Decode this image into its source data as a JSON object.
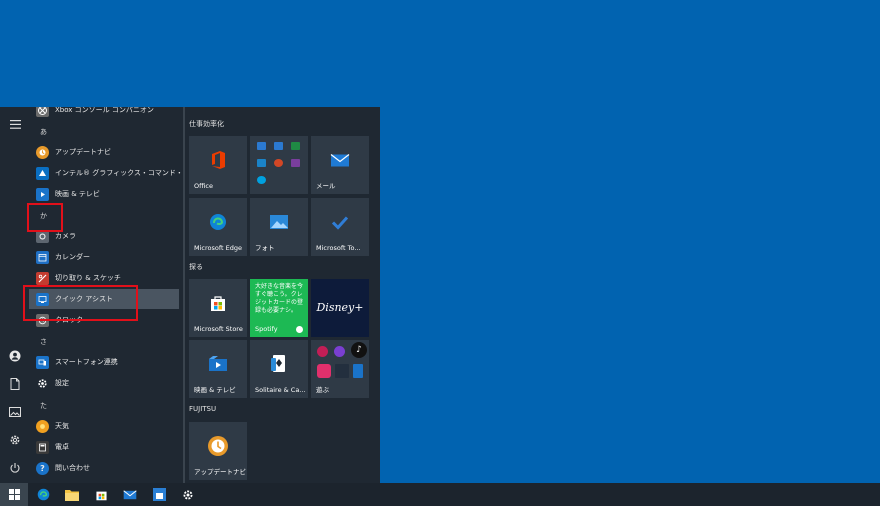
{
  "app_list": {
    "items": [
      {
        "label": "Xbox コンソール コンパニオン",
        "icon": "xbox-companion-icon",
        "color": "#6b6b6b"
      },
      {
        "letter": "あ"
      },
      {
        "label": "アップデートナビ",
        "icon": "update-navi-icon",
        "color": "#e89a2b"
      },
      {
        "label": "インテル® グラフィックス・コマンド・センター",
        "icon": "intel-graphics-icon",
        "color": "#0a6fc2"
      },
      {
        "label": "映画 & テレビ",
        "icon": "movies-tv-icon",
        "color": "#1a73c9"
      },
      {
        "letter": "か"
      },
      {
        "label": "カメラ",
        "icon": "camera-icon",
        "color": "#5d6670"
      },
      {
        "label": "カレンダー",
        "icon": "calendar-icon",
        "color": "#1f6fc4"
      },
      {
        "label": "切り取り & スケッチ",
        "icon": "snip-sketch-icon",
        "color": "#c43c30"
      },
      {
        "label": "クイック アシスト",
        "icon": "quick-assist-icon",
        "color": "#1a73c9"
      },
      {
        "label": "クロック",
        "icon": "clock-icon",
        "color": "#6b6b6b"
      },
      {
        "letter": "さ"
      },
      {
        "label": "スマートフォン連携",
        "icon": "phone-link-icon",
        "color": "#1a73c9"
      },
      {
        "label": "設定",
        "icon": "gear-icon",
        "color": "#1f2832"
      },
      {
        "letter": "た"
      },
      {
        "label": "天気",
        "icon": "weather-icon",
        "color": "#f0a020"
      },
      {
        "label": "電卓",
        "icon": "calculator-icon",
        "color": "#3a3a3a"
      },
      {
        "label": "問い合わせ",
        "icon": "help-icon",
        "color": "#1a73c9"
      }
    ]
  },
  "tile_groups": {
    "productivity": "仕事効率化",
    "explore": "探る",
    "fujitsu": "FUJITSU"
  },
  "tiles": {
    "office": "Office",
    "mail": "メール",
    "edge": "Microsoft Edge",
    "photos": "フォト",
    "todo": "Microsoft To...",
    "store": "Microsoft Store",
    "spotify_label": "Spotify",
    "spotify_text": "大好きな音楽を今すぐ聴こう。クレジットカードの登録も必要ナシ。",
    "disney": "Disney+",
    "movies": "映画 & テレビ",
    "solitaire": "Solitaire & Ca...",
    "play": "遊ぶ",
    "update_navi": "アップデートナビ"
  },
  "colors": {
    "accent": "#0063b1",
    "start_bg": "#1f2832",
    "tile_bg": "#2f3a46",
    "spotify": "#1db954",
    "disney": "#0d1b3a",
    "highlight_box": "#e1101a"
  }
}
